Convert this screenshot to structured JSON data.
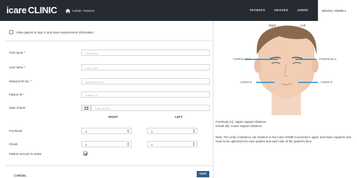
{
  "header": {
    "brand_prefix": "icare",
    "brand_suffix": "CLINIC",
    "breadcrumb": "Patients",
    "nav": [
      "PATIENTS",
      "DEVICES",
      "USERS"
    ],
    "user": "BOUGH, ADMIN ▾"
  },
  "form": {
    "allow_label": "Allow patient to sign in and view measurement information",
    "fields": [
      {
        "label": "First name *",
        "placeholder": "First name"
      },
      {
        "label": "Last name *",
        "placeholder": "Last name"
      },
      {
        "label": "National ID No. *",
        "placeholder": "National ID No."
      },
      {
        "label": "Patient ID *",
        "placeholder": "Patient ID"
      }
    ],
    "dob_label": "Date of birth",
    "dob_placeholder": "Date of birth",
    "col_right": "RIGHT",
    "col_left": "LEFT",
    "forehead_label": "Forehead",
    "forehead_right": "0",
    "forehead_left": "0",
    "cheek_label": "Cheek",
    "cheek_right": "0",
    "cheek_left": "0",
    "active_label": "Patient account is active",
    "active_checked": true,
    "cancel": "CANCEL",
    "save": "SAVE"
  },
  "diagram": {
    "right": "Right",
    "left": "Left",
    "forehead_a": "FOREHEAD A",
    "cheek_b": "CHEEK B",
    "legend_1": "Forehead (A):  Upper support distance",
    "legend_2": "Cheek (B):      Lower support distance",
    "note": "Note: The units of distance are marked on the Icare HOME tonometer's upper and lower supports and need to be optimized for each patient and each side of the patient's face.",
    "accent": "#1b8bc9",
    "skin": "#f1cdb3",
    "hair": "#8a6a4c"
  }
}
